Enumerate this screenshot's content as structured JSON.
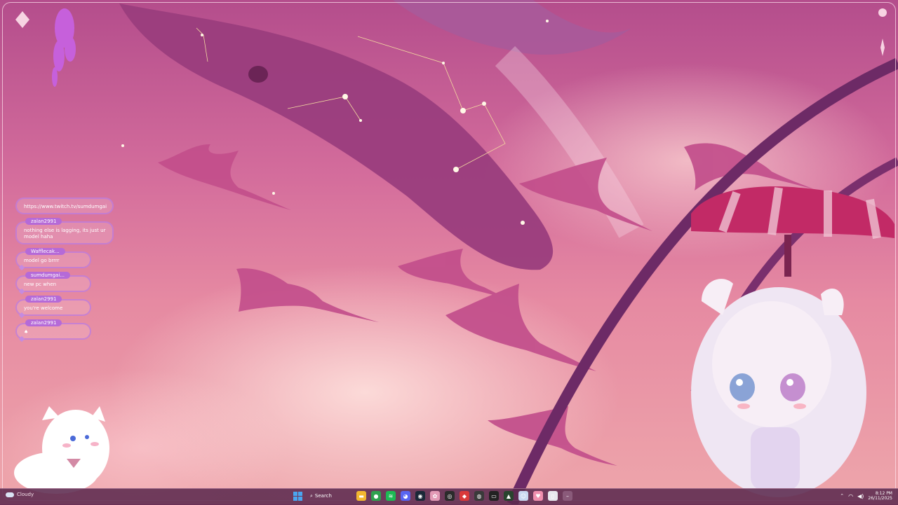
{
  "chat": {
    "messages": [
      {
        "user": "",
        "text": "https://www.twitch.tv/sumdumgai"
      },
      {
        "user": "zalan2991",
        "text": "nothing else is lagging, its just ur model haha"
      },
      {
        "user": "Wafflecak...",
        "text": "model go brrrr"
      },
      {
        "user": "sumdumgai...",
        "text": "new pc when"
      },
      {
        "user": "zalan2991",
        "text": "you're welcome"
      },
      {
        "user": "zalan2991",
        "text": "♠"
      }
    ]
  },
  "taskbar": {
    "weather": "Cloudy",
    "search_label": "Search",
    "clock_time": "8:12 PM",
    "clock_date": "26/11/2025",
    "apps": [
      {
        "name": "file-explorer-icon",
        "color": "#f2b730",
        "glyph": "▬"
      },
      {
        "name": "chrome-icon",
        "color": "#2fa14f",
        "glyph": "●"
      },
      {
        "name": "spotify-icon",
        "color": "#1db954",
        "glyph": "≋"
      },
      {
        "name": "discord-icon",
        "color": "#5865f2",
        "glyph": "◕"
      },
      {
        "name": "steam-icon",
        "color": "#1b2838",
        "glyph": "◉"
      },
      {
        "name": "pink-app-icon",
        "color": "#e39ab6",
        "glyph": "✿"
      },
      {
        "name": "obs-icon",
        "color": "#2b2b2b",
        "glyph": "◎"
      },
      {
        "name": "red-app-icon",
        "color": "#d93a3a",
        "glyph": "◆"
      },
      {
        "name": "app-icon",
        "color": "#3a3a3a",
        "glyph": "◍"
      },
      {
        "name": "terminal-icon",
        "color": "#222222",
        "glyph": "▭"
      },
      {
        "name": "green-app-icon",
        "color": "#29442e",
        "glyph": "▲"
      },
      {
        "name": "vtube-icon",
        "color": "#c9d7ef",
        "glyph": "☺"
      },
      {
        "name": "heart-app-icon",
        "color": "#f08fae",
        "glyph": "♥"
      },
      {
        "name": "file-icon",
        "color": "#e8e8ee",
        "glyph": "▯"
      },
      {
        "name": "minus-icon",
        "color": "#8a5a7a",
        "glyph": "–"
      }
    ]
  }
}
